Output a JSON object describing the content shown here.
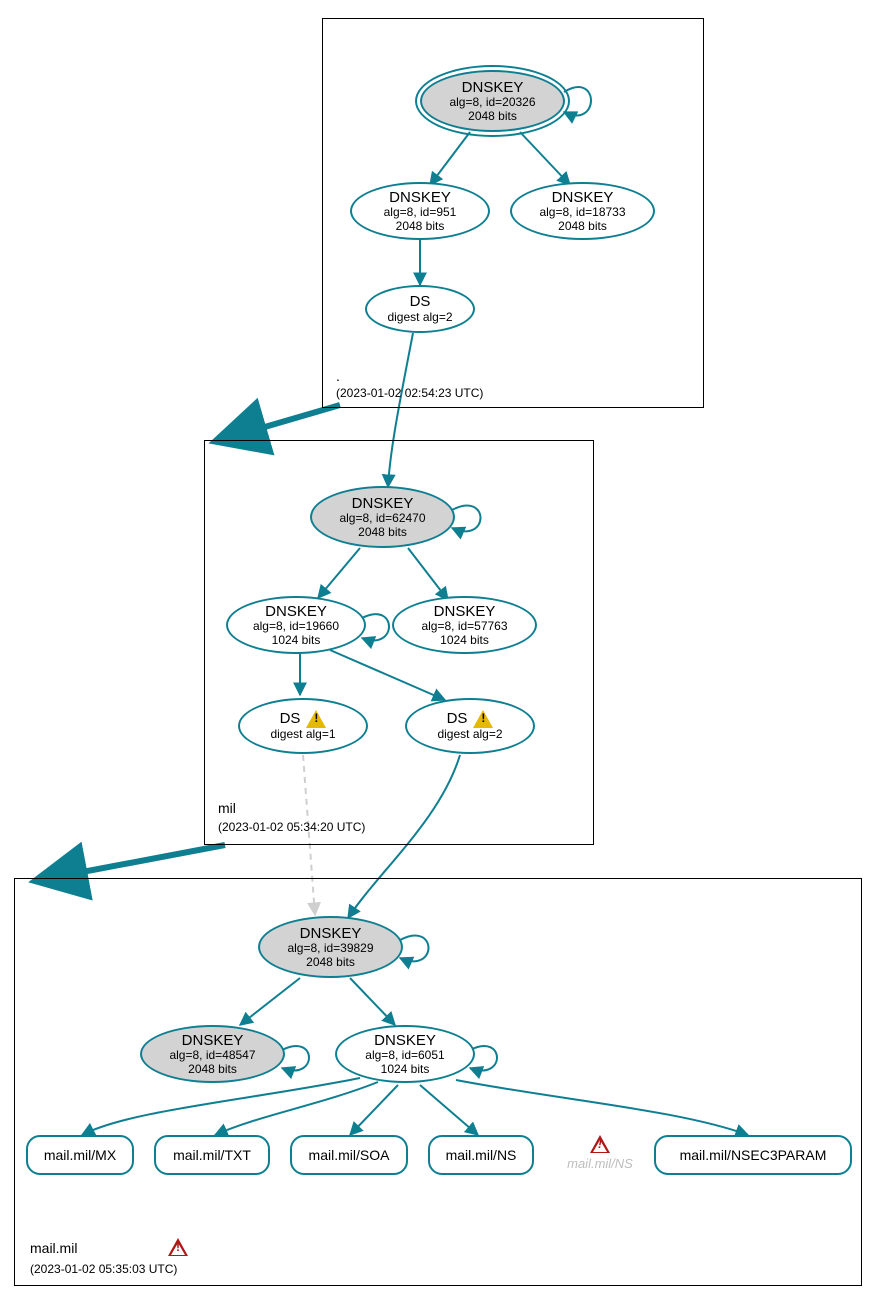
{
  "zones": {
    "root": {
      "name": ".",
      "timestamp": "(2023-01-02 02:54:23 UTC)"
    },
    "mil": {
      "name": "mil",
      "timestamp": "(2023-01-02 05:34:20 UTC)"
    },
    "mailmil": {
      "name": "mail.mil",
      "timestamp": "(2023-01-02 05:35:03 UTC)"
    }
  },
  "nodes": {
    "root_ksk": {
      "title": "DNSKEY",
      "sub1": "alg=8, id=20326",
      "sub2": "2048 bits"
    },
    "root_zsk1": {
      "title": "DNSKEY",
      "sub1": "alg=8, id=951",
      "sub2": "2048 bits"
    },
    "root_zsk2": {
      "title": "DNSKEY",
      "sub1": "alg=8, id=18733",
      "sub2": "2048 bits"
    },
    "root_ds": {
      "title": "DS",
      "sub1": "digest alg=2"
    },
    "mil_ksk": {
      "title": "DNSKEY",
      "sub1": "alg=8, id=62470",
      "sub2": "2048 bits"
    },
    "mil_zsk1": {
      "title": "DNSKEY",
      "sub1": "alg=8, id=19660",
      "sub2": "1024 bits"
    },
    "mil_zsk2": {
      "title": "DNSKEY",
      "sub1": "alg=8, id=57763",
      "sub2": "1024 bits"
    },
    "mil_ds1": {
      "title": "DS",
      "sub1": "digest alg=1"
    },
    "mil_ds2": {
      "title": "DS",
      "sub1": "digest alg=2"
    },
    "mm_ksk": {
      "title": "DNSKEY",
      "sub1": "alg=8, id=39829",
      "sub2": "2048 bits"
    },
    "mm_k2": {
      "title": "DNSKEY",
      "sub1": "alg=8, id=48547",
      "sub2": "2048 bits"
    },
    "mm_zsk": {
      "title": "DNSKEY",
      "sub1": "alg=8, id=6051",
      "sub2": "1024 bits"
    }
  },
  "records": {
    "mx": "mail.mil/MX",
    "txt": "mail.mil/TXT",
    "soa": "mail.mil/SOA",
    "ns": "mail.mil/NS",
    "ghost": "mail.mil/NS",
    "nsec": "mail.mil/NSEC3PARAM"
  }
}
